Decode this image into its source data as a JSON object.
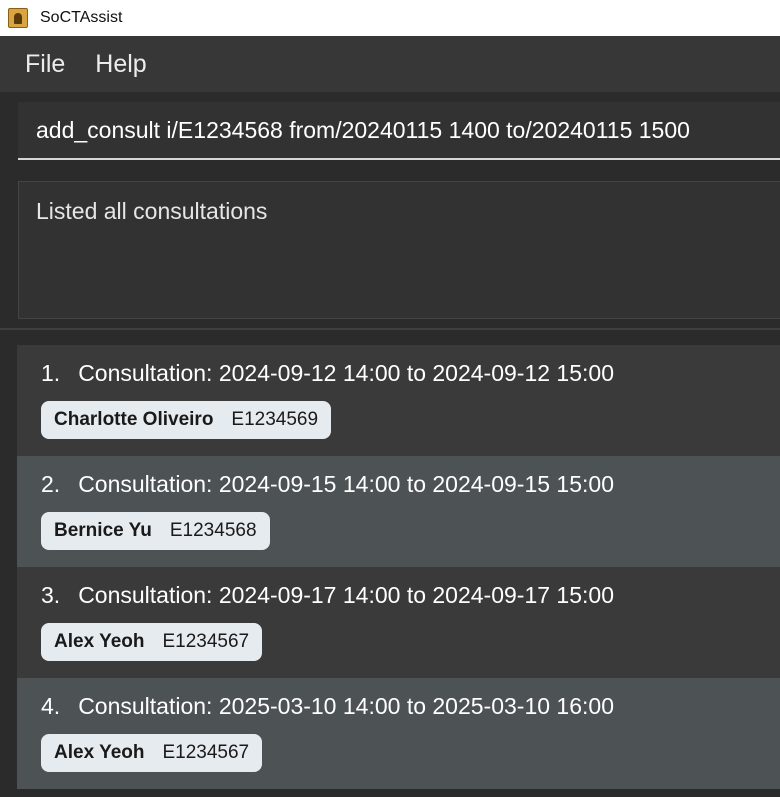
{
  "window": {
    "title": "SoCTAssist"
  },
  "menu": {
    "items": [
      "File",
      "Help"
    ]
  },
  "command": {
    "value": "add_consult i/E1234568 from/20240115 1400 to/20240115 1500"
  },
  "result": {
    "text": "Listed all consultations"
  },
  "consultations": [
    {
      "index": "1.",
      "title": "Consultation: 2024-09-12 14:00 to 2024-09-12 15:00",
      "name": "Charlotte Oliveiro",
      "id": "E1234569"
    },
    {
      "index": "2.",
      "title": "Consultation: 2024-09-15 14:00 to 2024-09-15 15:00",
      "name": "Bernice Yu",
      "id": "E1234568"
    },
    {
      "index": "3.",
      "title": "Consultation: 2024-09-17 14:00 to 2024-09-17 15:00",
      "name": "Alex Yeoh",
      "id": "E1234567"
    },
    {
      "index": "4.",
      "title": "Consultation: 2025-03-10 14:00 to 2025-03-10 16:00",
      "name": "Alex Yeoh",
      "id": "E1234567"
    }
  ],
  "colors": {
    "menubar": "#373737",
    "background": "#2b2b2b",
    "row_alt": "#4d5254",
    "tag": "#e6ebf0"
  },
  "icons": {
    "app": "app-icon"
  }
}
